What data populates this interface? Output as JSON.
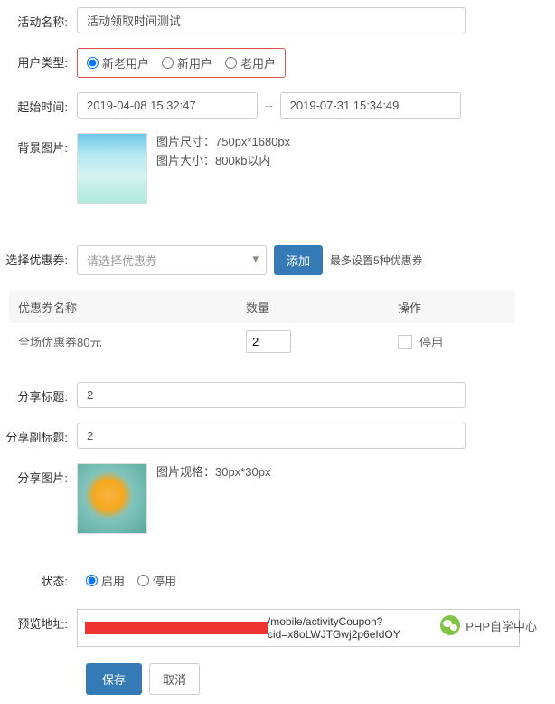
{
  "labels": {
    "activity_name": "活动名称:",
    "user_type": "用户类型:",
    "start_time": "起始时间:",
    "bg_image": "背景图片:",
    "select_coupon": "选择优惠券:",
    "share_title": "分享标题:",
    "share_subtitle": "分享副标题:",
    "share_image": "分享图片:",
    "status": "状态:",
    "preview_url": "预览地址:"
  },
  "activity_name": "活动领取时间测试",
  "user_type": {
    "options": [
      "新老用户",
      "新用户",
      "老用户"
    ],
    "selected": "新老用户"
  },
  "time": {
    "start": "2019-04-08 15:32:47",
    "sep": "--",
    "end": "2019-07-31 15:34:49"
  },
  "bg_info": {
    "size_label": "图片尺寸：750px*1680px",
    "filesize_label": "图片大小：800kb以内"
  },
  "coupon": {
    "placeholder": "请选择优惠券",
    "add_btn": "添加",
    "hint": "最多设置5种优惠券"
  },
  "table": {
    "headers": [
      "优惠券名称",
      "数量",
      "操作"
    ],
    "rows": [
      {
        "name": "全场优惠券80元",
        "qty": "2",
        "action": "停用"
      }
    ]
  },
  "share": {
    "title_val": "2",
    "subtitle_val": "2",
    "img_spec": "图片规格：30px*30px"
  },
  "status": {
    "options": [
      "启用",
      "停用"
    ],
    "selected": "启用"
  },
  "preview_url": "/mobile/activityCoupon?cid=x8oLWJTGwj2p6eIdOY",
  "buttons": {
    "save": "保存",
    "cancel": "取消"
  },
  "footer": "PHP自学中心"
}
